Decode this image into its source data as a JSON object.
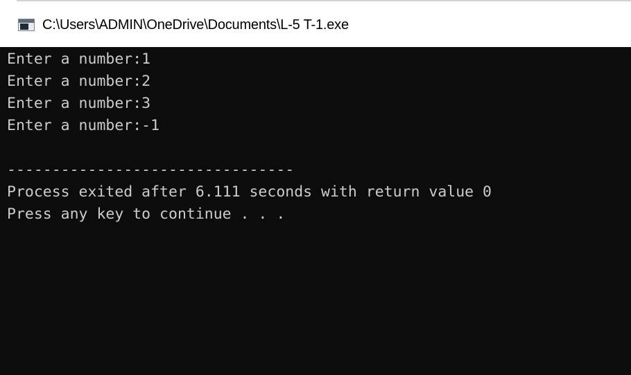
{
  "window": {
    "title": "C:\\Users\\ADMIN\\OneDrive\\Documents\\L-5 T-1.exe",
    "icon": "console-app-icon"
  },
  "console": {
    "lines": [
      "Enter a number:1",
      "Enter a number:2",
      "Enter a number:3",
      "Enter a number:-1",
      "",
      "--------------------------------",
      "Process exited after 6.111 seconds with return value 0",
      "Press any key to continue . . ."
    ]
  },
  "colors": {
    "console_background": "#0c0c0c",
    "console_text": "#cccccc",
    "titlebar_background": "#ffffff"
  }
}
